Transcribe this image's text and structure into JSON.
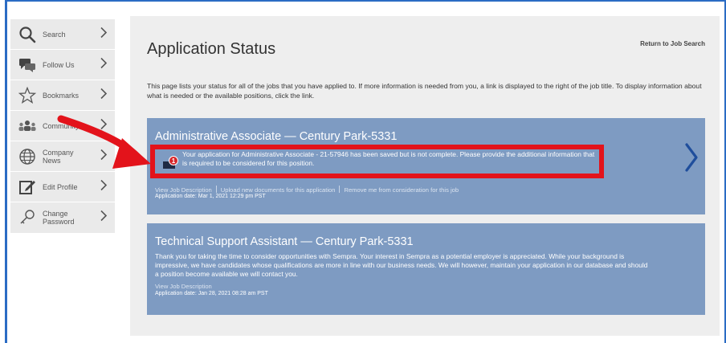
{
  "sidebar": {
    "items": [
      {
        "label": "Search",
        "icon": "search-icon"
      },
      {
        "label": "Follow Us",
        "icon": "chat-bubbles-icon"
      },
      {
        "label": "Bookmarks",
        "icon": "star-icon"
      },
      {
        "label": "Community",
        "icon": "people-icon"
      },
      {
        "label": "Company News",
        "icon": "globe-icon"
      },
      {
        "label": "Edit Profile",
        "icon": "edit-icon"
      },
      {
        "label": "Change Password",
        "icon": "key-icon"
      }
    ]
  },
  "main": {
    "title": "Application Status",
    "return_link": "Return to Job Search",
    "intro": "This page lists your status for all of the jobs that you have applied to. If more information is needed from you, a link is displayed to the right of the job title. To display information about what is needed or the available positions, click the link."
  },
  "applications": [
    {
      "title": "Administrative Associate — Century Park-5331",
      "badge_count": "1",
      "status_message": "Your application for Administrative Associate - 21-57946 has been saved but is not complete. Please provide the additional information that is required to be considered for this position.",
      "links": [
        "View Job Description",
        "Upload new documents for this application",
        "Remove me from consideration for this job"
      ],
      "date": "Application date: Mar 1, 2021 12:29 pm PST"
    },
    {
      "title": "Technical Support Assistant — Century Park-5331",
      "message": "Thank you for taking the time to consider opportunities with Sempra. Your interest in Sempra as a potential employer is appreciated. While your background is impressive, we have candidates whose qualifications are more in line with our business needs. We will however, maintain your application in our database and should a position become available we will contact you.",
      "link": "View Job Description",
      "date": "Application date: Jan 28, 2021 08:28 am PST"
    }
  ],
  "colors": {
    "card_bg": "#7e9bc2",
    "highlight_red": "#e3131b",
    "chevron_blue": "#1f4e9c",
    "frame_blue": "#2b6cc4"
  }
}
